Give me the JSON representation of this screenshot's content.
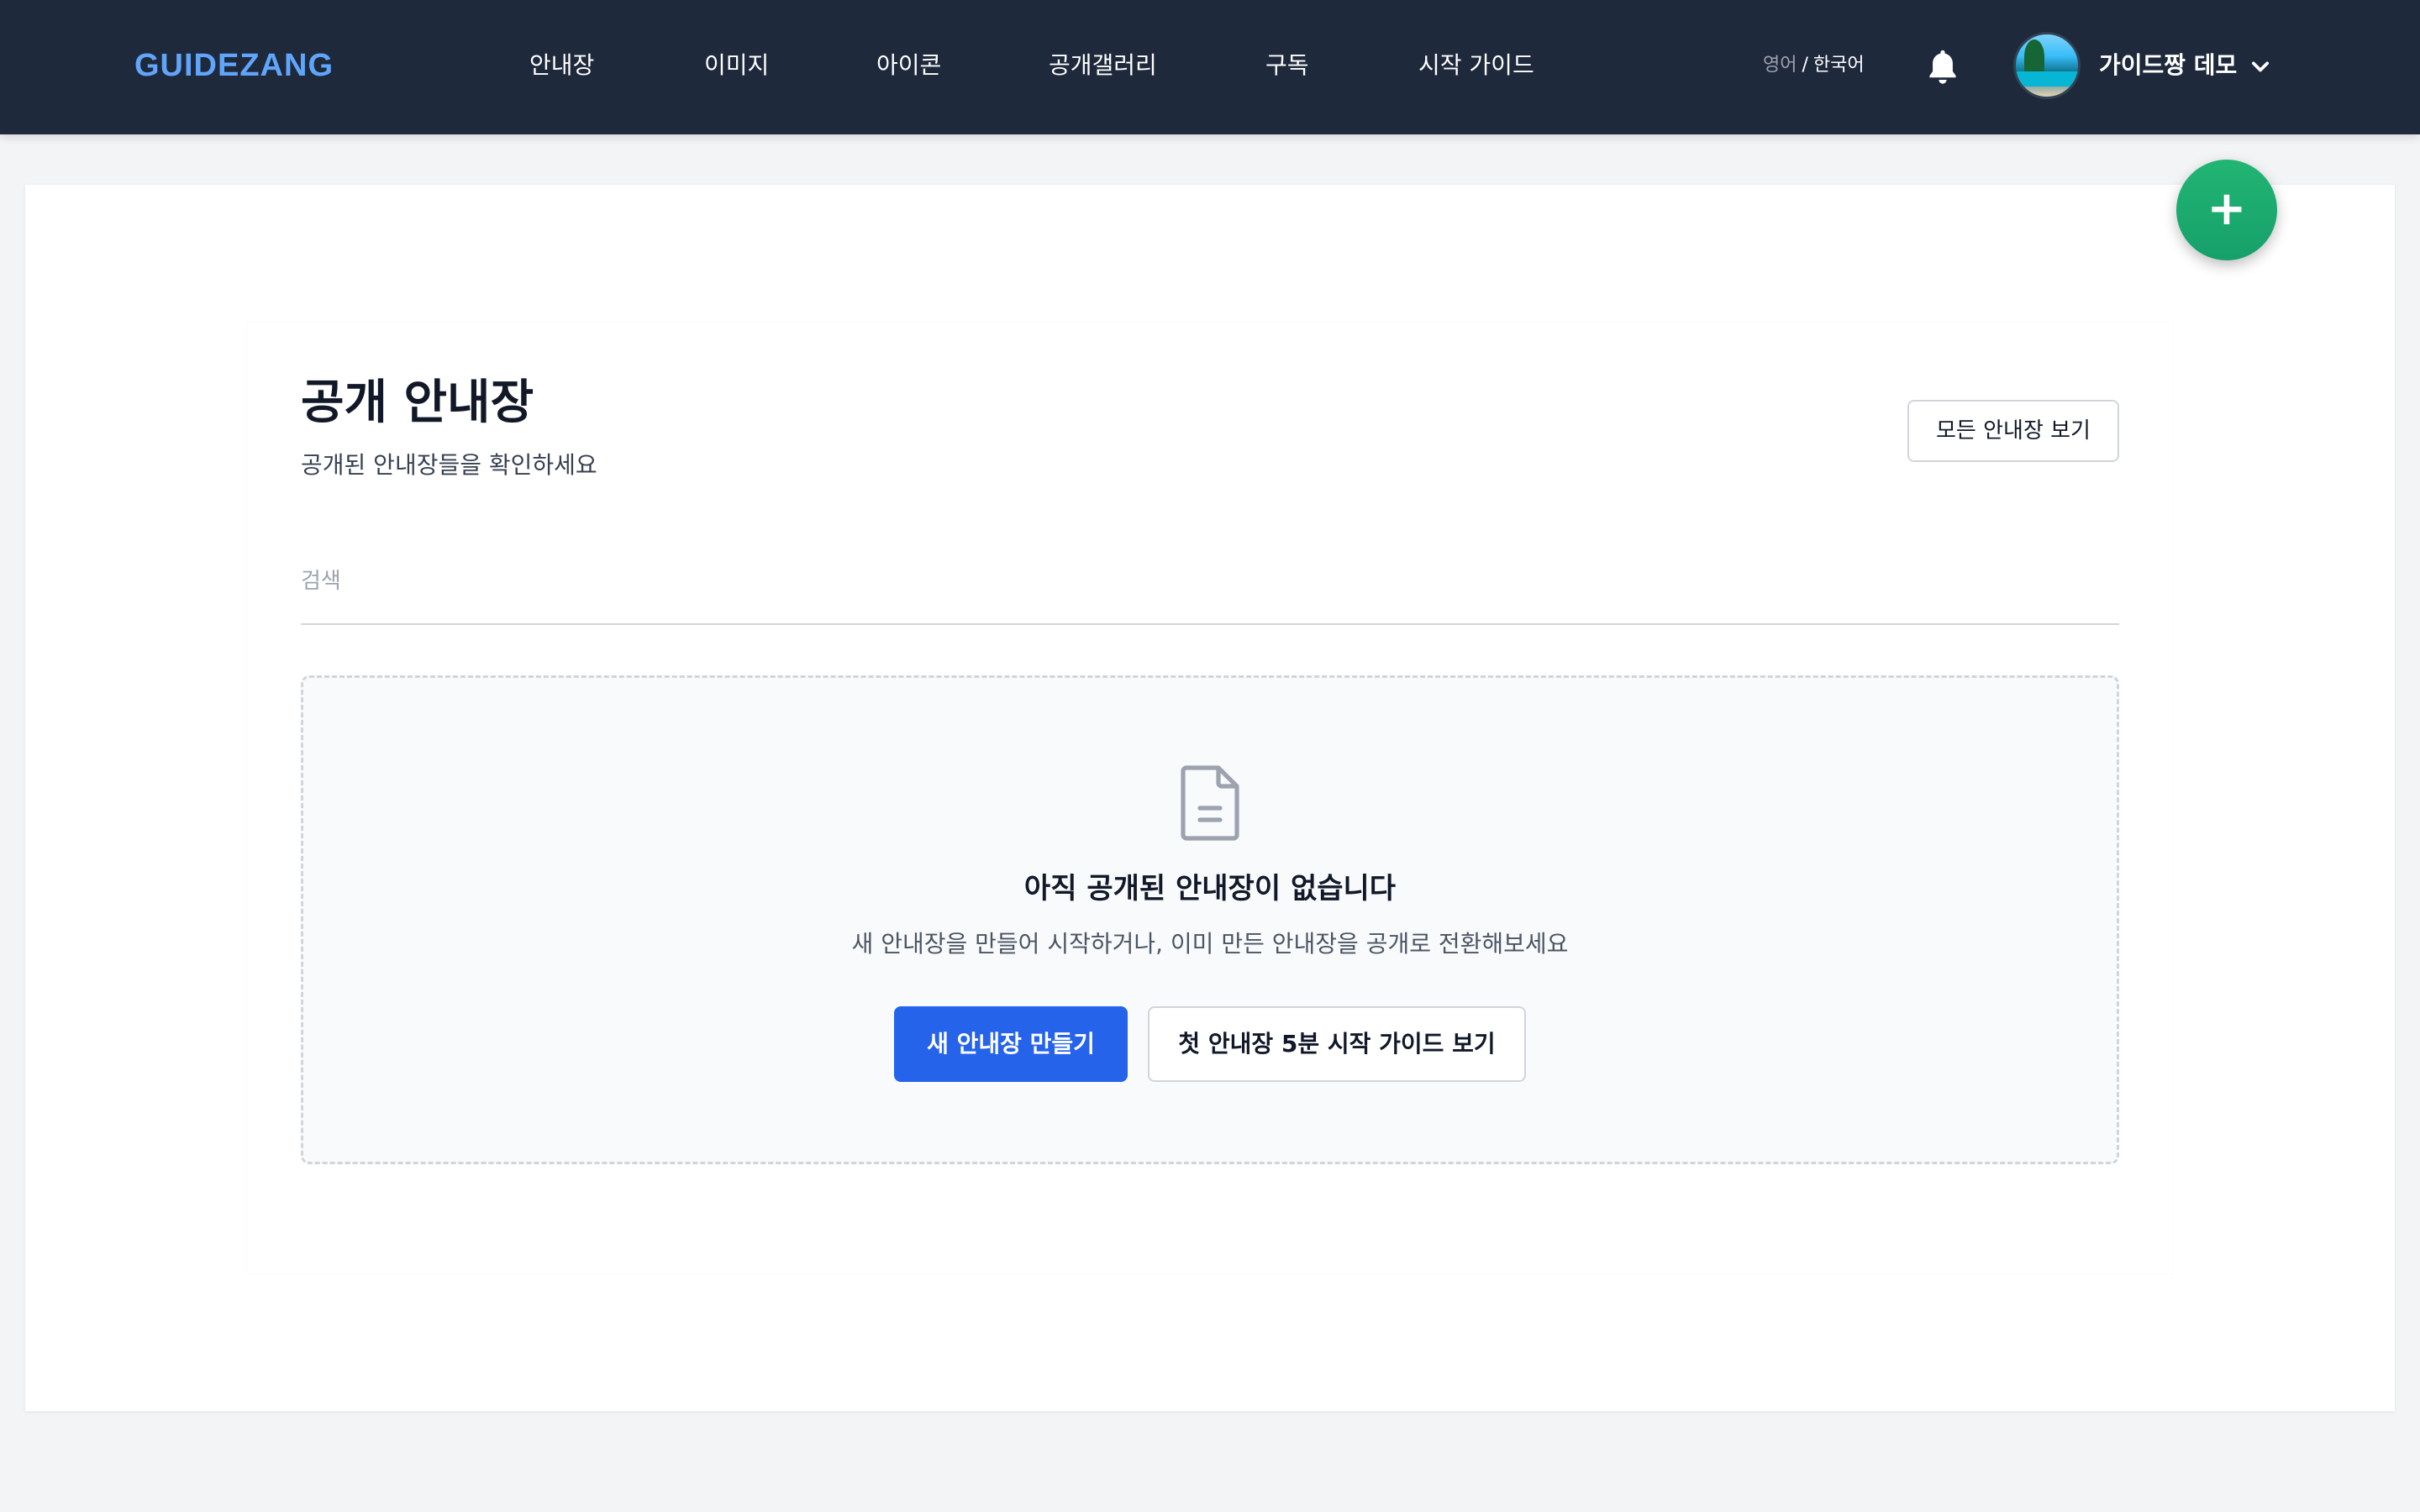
{
  "header": {
    "logo": "GUIDEZANG",
    "nav": [
      {
        "label": "안내장"
      },
      {
        "label": "이미지"
      },
      {
        "label": "아이콘"
      },
      {
        "label": "공개갤러리"
      },
      {
        "label": "구독"
      },
      {
        "label": "시작 가이드"
      }
    ],
    "lang_inactive": "영어",
    "lang_separator": "/",
    "lang_active": "한국어",
    "username": "가이드짱 데모",
    "icons": {
      "notification": "bell-icon",
      "account_menu": "chevron-down-icon",
      "avatar": "user-avatar"
    }
  },
  "fab": {
    "label": "+"
  },
  "page": {
    "title": "공개 안내장",
    "subtitle": "공개된 안내장들을 확인하세요",
    "view_all_button": "모든 안내장 보기",
    "search_placeholder": "검색",
    "search_value": ""
  },
  "empty_state": {
    "icon": "document-icon",
    "title": "아직 공개된 안내장이 없습니다",
    "description": "새 안내장을 만들어 시작하거나, 이미 만든 안내장을 공개로 전환해보세요",
    "primary_button": "새 안내장 만들기",
    "secondary_button": "첫 안내장 5분 시작 가이드 보기"
  },
  "colors": {
    "header_bg": "#1e293b",
    "logo": "#60a5fa",
    "primary": "#2563eb",
    "fab": "#16a06a"
  }
}
